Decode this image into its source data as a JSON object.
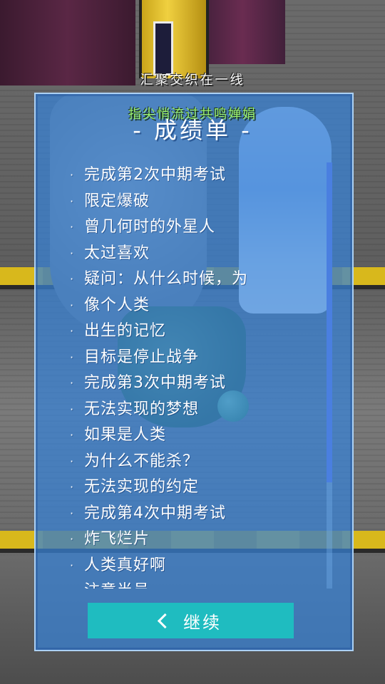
{
  "captions": {
    "line1": "汇聚交织在一线",
    "line2": "指尖悄流过共鸣婵娟"
  },
  "scorecard": {
    "title": "- 成绩单 -",
    "bullet": "·",
    "items": [
      "完成第2次中期考试",
      "限定爆破",
      "曾几何时的外星人",
      "太过喜欢",
      "疑问：从什么时候，为",
      "像个人类",
      "出生的记忆",
      "目标是停止战争",
      "完成第3次中期考试",
      "无法实现的梦想",
      "如果是人类",
      "为什么不能杀？",
      "无法实现的约定",
      "完成第4次中期考试",
      "炸飞烂片",
      "人类真好啊",
      "注意半员"
    ],
    "scroll_position": 0.0,
    "scroll_visible_fraction": 0.75,
    "continue_label": "继续",
    "continue_icon": "chevron-left-icon"
  },
  "colors": {
    "panel": "#3782d7",
    "button": "#1fbcc0",
    "caption_green": "#9cf06e",
    "scroll_thumb": "#4a7fe0"
  }
}
